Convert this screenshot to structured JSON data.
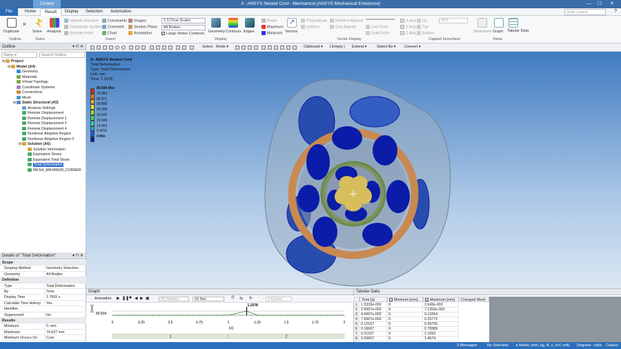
{
  "titlebar": {
    "context_tab": "Context",
    "title": "A : ANSYS Nested Cord - Mechanical [ANSYS Mechanical Enterprise]",
    "window_controls": [
      "—",
      "☐",
      "✕"
    ]
  },
  "tabs": [
    "File",
    "Home",
    "Result",
    "Display",
    "Selection",
    "Automation"
  ],
  "active_tab": "Result",
  "search": {
    "placeholder": "Quick Launch"
  },
  "ribbon": {
    "duplicate": "Duplicate",
    "solve": "Solve",
    "analysis": "Analysis",
    "named_selection": "Named Selection",
    "coordinate_system": "Coordinate System",
    "remote_point": "Remote Point",
    "commands": "Commands",
    "comment": "Comment",
    "chart": "Chart",
    "images": "Images",
    "section_plane": "Section Plane",
    "annotation": "Annotation",
    "scale_value": "1.0 (True Scale)",
    "all_bodies": "All Bodies",
    "large_vertex": "Large Vertex Contours",
    "geometry": "Geometry",
    "contours": "Contours",
    "edges": "Edges",
    "probe": "Probe",
    "maximum": "Maximum",
    "minimum": "Minimum",
    "vectors": "Vectors",
    "proportional": "Proportional",
    "uniform": "Uniform",
    "element_aligned": "Element Aligned",
    "grid_aligned": "Grid Aligned",
    "line_form": "Line Form",
    "solid_form": "Solid Form",
    "x_axis": "X Axis",
    "y_axis": "Y Axis",
    "z_axis": "Z Axis",
    "iso_value": "79.6",
    "iso": "Iso",
    "top": "Top",
    "bottom": "Bottom",
    "worksheet": "Worksheet",
    "graph": "Graph",
    "tabular_data": "Tabular Data",
    "groups": {
      "outline": "Outline",
      "solve": "Solve",
      "insert": "Insert",
      "display": "Display",
      "vector_display": "Vector Display",
      "capped": "Capped Isosurface",
      "views": "Views"
    }
  },
  "toolbar": {
    "select": "Select",
    "mode": "Mode",
    "clipboard": "Clipboard",
    "empty": "[ Empty ]",
    "extend": "Extend",
    "select_by": "Select By",
    "convert": "Convert"
  },
  "outline": {
    "title": "Outline",
    "name_filter": "Name",
    "search_placeholder": "Search Outline",
    "items": [
      {
        "label": "Project",
        "depth": 0,
        "bold": true,
        "icon": "#d9a33a"
      },
      {
        "label": "Model (A4)",
        "depth": 1,
        "bold": true,
        "icon": "#d9a33a"
      },
      {
        "label": "Geometry",
        "depth": 2,
        "icon": "#3a8ac9"
      },
      {
        "label": "Materials",
        "depth": 2,
        "icon": "#7aa84a"
      },
      {
        "label": "Virtual Topology",
        "depth": 2,
        "icon": "#7aa84a"
      },
      {
        "label": "Coordinate Systems",
        "depth": 2,
        "icon": "#b07ac0"
      },
      {
        "label": "Connections",
        "depth": 2,
        "icon": "#c09040"
      },
      {
        "label": "Mesh",
        "depth": 2,
        "icon": "#4a9ad0"
      },
      {
        "label": "Static Structural (A5)",
        "depth": 2,
        "bold": true,
        "icon": "#5a88c8"
      },
      {
        "label": "Analysis Settings",
        "depth": 3,
        "icon": "#6a9ad0"
      },
      {
        "label": "Remote Displacement",
        "depth": 3,
        "icon": "#4aa86a"
      },
      {
        "label": "Remote Displacement 2",
        "depth": 3,
        "icon": "#4aa86a"
      },
      {
        "label": "Remote Displacement 3",
        "depth": 3,
        "icon": "#4aa86a"
      },
      {
        "label": "Remote Displacement 4",
        "depth": 3,
        "icon": "#4aa86a"
      },
      {
        "label": "Nonlinear Adaptive Region",
        "depth": 3,
        "icon": "#4aa86a"
      },
      {
        "label": "Nonlinear Adaptive Region 3",
        "depth": 3,
        "icon": "#4aa86a"
      },
      {
        "label": "Solution (A6)",
        "depth": 3,
        "bold": true,
        "icon": "#d9a33a"
      },
      {
        "label": "Solution Information",
        "depth": 4,
        "icon": "#d9a33a"
      },
      {
        "label": "Equivalent Stress",
        "depth": 4,
        "icon": "#4aa86a"
      },
      {
        "label": "Equivalent Total Strain",
        "depth": 4,
        "icon": "#4aa86a"
      },
      {
        "label": "Total Deformation",
        "depth": 4,
        "icon": "#4aa86a",
        "selected": true
      },
      {
        "label": "MESH_MAXIMUM_CORNER",
        "depth": 4,
        "icon": "#4aa86a"
      }
    ]
  },
  "details": {
    "title": "Details of \"Total Deformation\"",
    "rows": [
      {
        "section": "Scope"
      },
      {
        "k": "Scoping Method",
        "v": "Geometry Selection"
      },
      {
        "k": "Geometry",
        "v": "All Bodies"
      },
      {
        "section": "Definition"
      },
      {
        "k": "Type",
        "v": "Total Deformation"
      },
      {
        "k": "By",
        "v": "Time"
      },
      {
        "k": "Display Time",
        "v": "1.7655 s"
      },
      {
        "k": "Calculate Time History",
        "v": "Yes"
      },
      {
        "k": "Identifier",
        "v": ""
      },
      {
        "k": "Suppressed",
        "v": "No"
      },
      {
        "section": "Results"
      },
      {
        "k": "Minimum",
        "v": "0. mm"
      },
      {
        "k": "Maximum",
        "v": "74.537 mm"
      },
      {
        "k": "Minimum Occurs On",
        "v": "Core"
      }
    ]
  },
  "viewport": {
    "info": [
      "A: ANSYS Nested Cord",
      "Total Deformation",
      "Type: Total Deformation",
      "Unit: mm",
      "Time: 1.1578"
    ],
    "legend": [
      {
        "label": "89.834 Max",
        "color": "#e0231c"
      },
      {
        "label": "79.853",
        "color": "#f0701a"
      },
      {
        "label": "69.871",
        "color": "#f3b823"
      },
      {
        "label": "59.889",
        "color": "#e8e830"
      },
      {
        "label": "49.908",
        "color": "#9bdc3a"
      },
      {
        "label": "39.926",
        "color": "#3ad66a"
      },
      {
        "label": "29.945",
        "color": "#27d6c8"
      },
      {
        "label": "19.963",
        "color": "#1aa8e8"
      },
      {
        "label": "9.9816",
        "color": "#1a5cf0"
      },
      {
        "label": "0 Min",
        "color": "#0a1ca8"
      }
    ]
  },
  "graph": {
    "title": "Graph",
    "animation_label": "Animation",
    "frames": "20 Frames",
    "duration": "10 Sec",
    "cycles": "3 Cycles",
    "y_unit": "[mm]",
    "y_value": "89.834",
    "marker_value": "1.1578",
    "x_label": "[s]",
    "x_ticks": [
      "0",
      "0.25",
      "0.5",
      "0.75",
      "1",
      "1.25",
      "1.5",
      "1.75",
      "2"
    ],
    "steps": [
      "1",
      "2"
    ],
    "chart_data": {
      "type": "line",
      "x": [
        0,
        0.25,
        0.5,
        0.75,
        1,
        1.1578,
        1.25,
        1.5,
        1.75,
        2
      ],
      "series": [
        {
          "values": [
            0,
            0,
            0,
            0,
            0,
            89.834,
            0,
            0,
            0,
            0
          ]
        }
      ],
      "xlabel": "[s]",
      "ylabel": "[mm]",
      "xlim": [
        0,
        2
      ]
    }
  },
  "tabular": {
    "title": "Tabular Data",
    "headers": [
      "Time [s]",
      "Minimum [mm]",
      "Maximum [mm]",
      "Changed Mesh"
    ],
    "rows": [
      {
        "n": "1",
        "t": "1.3333e-002",
        "min": "0.",
        "max": "3.543e-002"
      },
      {
        "n": "2",
        "t": "2.6667e-002",
        "min": "0.",
        "max": "7.1356e-002"
      },
      {
        "n": "3",
        "t": "4.6667e-002",
        "min": "0.",
        "max": "0.13354"
      },
      {
        "n": "4",
        "t": "7.6667e-002",
        "min": "0.",
        "max": "0.25772"
      },
      {
        "n": "5",
        "t": "0.12167",
        "min": "0.",
        "max": "0.49756"
      },
      {
        "n": "6",
        "t": "0.16667",
        "min": "0.",
        "max": "0.78389"
      },
      {
        "n": "7",
        "t": "0.21167",
        "min": "0.",
        "max": "1.1093"
      },
      {
        "n": "8",
        "t": "0.25667",
        "min": "0.",
        "max": "1.4674"
      }
    ]
  },
  "status": {
    "messages": "3 Messages",
    "selection": "No Selection",
    "units": "Metric (mm, kg, N, s, mV, mA)",
    "angle": "Degrees",
    "rate": "rad/s",
    "temp": "Celsius"
  }
}
